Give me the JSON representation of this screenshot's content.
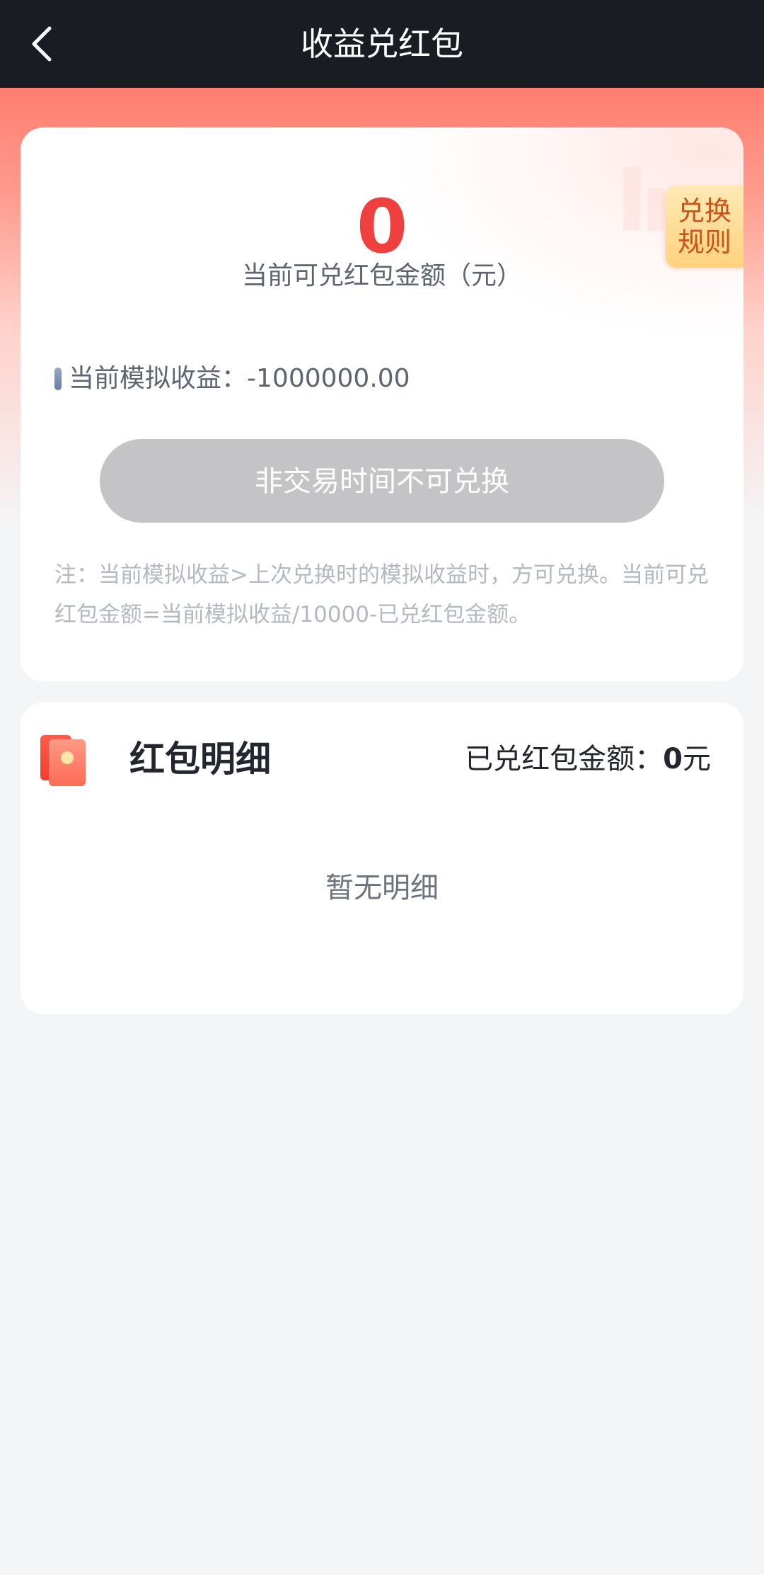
{
  "navbar": {
    "title": "收益兑红包",
    "back_icon": "chevron-left-icon"
  },
  "summary": {
    "amount": "0",
    "amount_label": "当前可兑红包金额（元）",
    "rule_tag": [
      "兑换",
      "规则"
    ],
    "sim_label": "当前模拟收益：",
    "sim_value": "-1000000.00",
    "button_label": "非交易时间不可兑换",
    "note": "注：当前模拟收益>上次兑换时的模拟收益时，方可兑换。当前可兑红包金额=当前模拟收益/10000-已兑红包金额。"
  },
  "detail": {
    "title": "红包明细",
    "icon": "red-packet-icon",
    "used_label": "已兑红包金额：",
    "used_value": "0",
    "used_unit": "元",
    "empty_text": "暂无明细"
  },
  "colors": {
    "navbar_bg": "#1A1C24",
    "accent_red": "#F03F3F",
    "button_disabled": "#C4C4C6",
    "rule_tag_text": "#C9541A"
  }
}
